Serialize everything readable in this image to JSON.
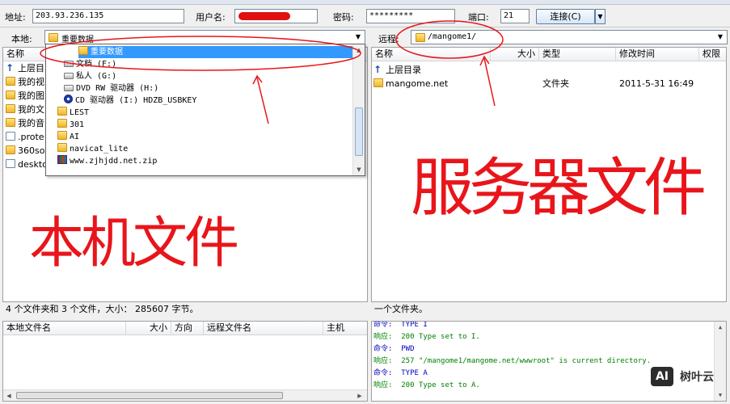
{
  "quickconnect": {
    "host_label": "地址:",
    "host_value": "203.93.236.135",
    "user_label": "用户名:",
    "pass_label": "密码:",
    "pass_value": "*********",
    "port_label": "端口:",
    "port_value": "21",
    "connect_label": "连接(C)"
  },
  "local": {
    "path_label": "本地:",
    "path_value": "重要数据",
    "columns": [
      "名称",
      "/"
    ],
    "rows": [
      {
        "name": "上层目",
        "icon": "up-arrow-icon"
      },
      {
        "name": "我的视",
        "icon": "folder-icon"
      },
      {
        "name": "我的图",
        "icon": "folder-icon"
      },
      {
        "name": "我的文",
        "icon": "folder-icon"
      },
      {
        "name": "我的音",
        "icon": "folder-icon"
      },
      {
        "name": ".prote",
        "icon": "file-icon"
      },
      {
        "name": "360so",
        "icon": "folder-icon"
      },
      {
        "name": "deskto",
        "icon": "file-icon"
      }
    ],
    "status": "4 个文件夹和 3 个文件，大小： 285607 字节。",
    "dropdown": [
      {
        "label": "重要数据",
        "icon": "folder-icon",
        "indent": 2,
        "selected": true
      },
      {
        "label": "文档 (F:)",
        "icon": "drive-icon",
        "indent": 1,
        "selected": false
      },
      {
        "label": "私人 (G:)",
        "icon": "drive-icon",
        "indent": 1,
        "selected": false
      },
      {
        "label": "DVD RW 驱动器 (H:)",
        "icon": "drive-icon",
        "indent": 1,
        "selected": false
      },
      {
        "label": "CD 驱动器 (I:) HDZB_USBKEY",
        "icon": "cd-icon",
        "indent": 1,
        "selected": false
      },
      {
        "label": "LEST",
        "icon": "folder-icon",
        "indent": 1,
        "selected": false
      },
      {
        "label": "301",
        "icon": "folder-icon",
        "indent": 1,
        "selected": false
      },
      {
        "label": "AI",
        "icon": "folder-icon",
        "indent": 1,
        "selected": false
      },
      {
        "label": "navicat_lite",
        "icon": "folder-icon",
        "indent": 1,
        "selected": false
      },
      {
        "label": "www.zjhjdd.net.zip",
        "icon": "zip-icon",
        "indent": 1,
        "selected": false
      }
    ]
  },
  "remote": {
    "path_label": "远程:",
    "path_value": "/mangome1/",
    "columns": [
      "名称",
      "大小",
      "类型",
      "修改时间",
      "权限"
    ],
    "rows": [
      {
        "name": "上层目录",
        "type": "",
        "modified": ""
      },
      {
        "name": "mangome.net",
        "type": "文件夹",
        "modified": "2011-5-31 16:49"
      }
    ],
    "status": "一个文件夹。"
  },
  "queue": {
    "columns": [
      "本地文件名",
      "大小",
      "方向",
      "远程文件名",
      "主机"
    ]
  },
  "log": [
    {
      "kind": "cmd",
      "label": "命令:",
      "text": "TYPE I"
    },
    {
      "kind": "ok",
      "label": "响应:",
      "text": "200 Type set to I."
    },
    {
      "kind": "cmd",
      "label": "命令:",
      "text": "PWD"
    },
    {
      "kind": "ok",
      "label": "响应:",
      "text": "257 \"/mangome1/mangome.net/wwwroot\" is current directory."
    },
    {
      "kind": "cmd",
      "label": "命令:",
      "text": "TYPE A"
    },
    {
      "kind": "ok",
      "label": "响应:",
      "text": "200 Type set to A."
    }
  ],
  "annotations": {
    "local_note": "本机文件",
    "remote_note": "服务器文件",
    "color": "#e8151b"
  },
  "watermark": {
    "badge": "AI",
    "text": "树叶云"
  }
}
